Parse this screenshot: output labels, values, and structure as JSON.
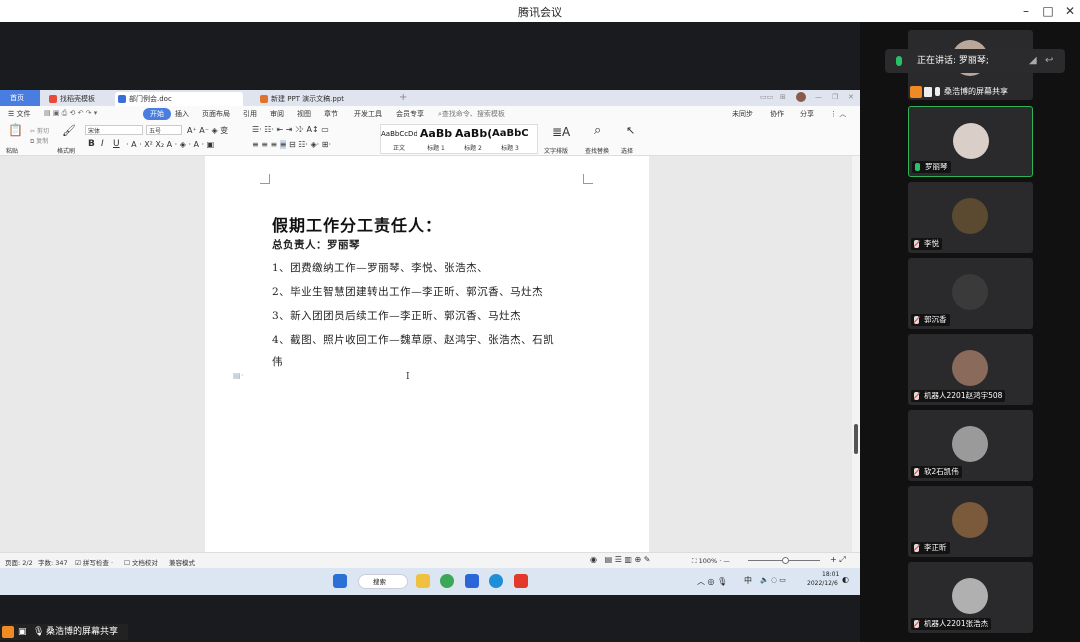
{
  "window": {
    "title": "腾讯会议",
    "controls": [
      "–",
      "□",
      "✕"
    ]
  },
  "wps": {
    "tabs": [
      {
        "label": "首页",
        "icon": "wps-home-icon"
      },
      {
        "label": "找稻壳模板",
        "icon": "docer-icon"
      },
      {
        "label": "部门例会.doc",
        "icon": "word-doc-icon"
      },
      {
        "label": "新建 PPT 演示文稿.ppt",
        "icon": "ppt-doc-icon"
      }
    ],
    "menus": [
      "文件",
      "开始",
      "插入",
      "页面布局",
      "引用",
      "审阅",
      "视图",
      "章节",
      "开发工具",
      "会员专享"
    ],
    "search_placeholder": "查找命令、搜索模板",
    "right_actions": [
      "未同步",
      "协作",
      "分享"
    ],
    "ribbon": {
      "paste": "粘贴",
      "cut": "剪切",
      "copy": "复制",
      "format_painter": "格式刷",
      "font": "宋体",
      "font_size": "五号",
      "styles": [
        {
          "preview": "AaBbCcDd",
          "caption": "正文"
        },
        {
          "preview": "AaBb",
          "caption": "标题 1"
        },
        {
          "preview": "AaBb(",
          "caption": "标题 2"
        },
        {
          "preview": "AaBbC",
          "caption": "标题 3"
        }
      ],
      "text_layout": "文字排版",
      "find_replace": "查找替换",
      "select": "选择"
    },
    "document": {
      "title": "假期工作分工责任人：",
      "lead": "总负责人：罗丽琴",
      "items": [
        "1、团费缴纳工作—罗丽琴、李悦、张浩杰、",
        "2、毕业生智慧团建转出工作—李正昕、郭沉香、马灶杰",
        "3、新入团团员后续工作—李正昕、郭沉香、马灶杰",
        "4、截图、照片收回工作—魏草原、赵鸿宇、张浩杰、石凯",
        "伟"
      ]
    },
    "status": {
      "page": "页面: 2/2",
      "words": "字数: 347",
      "spell": "拼写检查",
      "proof": "文档校对",
      "compat": "兼容模式",
      "zoom": "100%"
    }
  },
  "taskbar": {
    "search": "搜索",
    "ime": "中",
    "time": "18:01",
    "date": "2022/12/6"
  },
  "meeting": {
    "speaking_label": "正在讲话: 罗丽琴;",
    "share_label": "桑浩博的屏幕共享",
    "participants": [
      {
        "name": "罗丽琴",
        "mic": "on",
        "avatar_color": "#d9cfc8"
      },
      {
        "name": "李悦",
        "mic": "off",
        "avatar_color": "#5b4a30"
      },
      {
        "name": "郭沉香",
        "mic": "off",
        "avatar_color": "#3a3a3a"
      },
      {
        "name": "机器人2201赵鸿宇508",
        "mic": "off",
        "avatar_color": "#8a6a5a"
      },
      {
        "name": "软2石凯伟",
        "mic": "off",
        "avatar_color": "#9a9a9a"
      },
      {
        "name": "李正昕",
        "mic": "off",
        "avatar_color": "#7a5a3a"
      },
      {
        "name": "机器人2201张浩杰",
        "mic": "off",
        "avatar_color": "#b0b0b0"
      }
    ]
  },
  "colors": {
    "accent_blue": "#4a7de0",
    "speaking_green": "#26c267",
    "share_orange": "#f08a24"
  }
}
